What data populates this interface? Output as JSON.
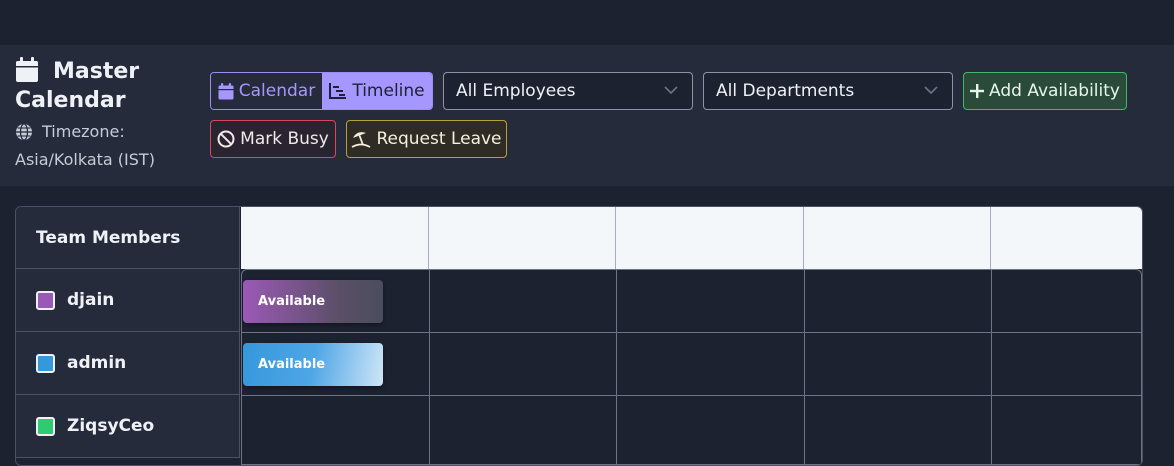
{
  "header": {
    "title_line1": "Master",
    "title_line2": "Calendar",
    "timezone_label": "Timezone:",
    "timezone_value": "Asia/Kolkata (IST)"
  },
  "toolbar": {
    "view_calendar_label": "Calendar",
    "view_timeline_label": "Timeline",
    "employee_select": "All Employees",
    "department_select": "All Departments",
    "add_availability_label": "Add Availability",
    "mark_busy_label": "Mark Busy",
    "request_leave_label": "Request Leave"
  },
  "grid": {
    "members_header": "Team Members",
    "members": [
      {
        "name": "djain",
        "color": "#9b59b6",
        "event": "Available"
      },
      {
        "name": "admin",
        "color": "#3498db",
        "event": "Available"
      },
      {
        "name": "ZiqsyCeo",
        "color": "#2ecc71",
        "event": ""
      }
    ]
  },
  "colors": {
    "accent": "#a597ff",
    "add": "#3fb767",
    "busy": "#d9475a",
    "leave": "#b8a032"
  }
}
